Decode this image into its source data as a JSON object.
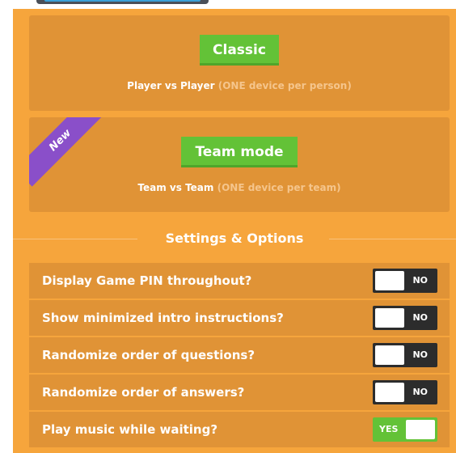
{
  "modes": {
    "classic": {
      "button_label": "Classic",
      "desc_main": "Player vs Player",
      "desc_note": "(ONE device per person)"
    },
    "team": {
      "badge": "New",
      "button_label": "Team mode",
      "desc_main": "Team vs Team",
      "desc_note": "(ONE device per team)"
    }
  },
  "settings": {
    "title": "Settings & Options",
    "items": [
      {
        "label": "Display Game PIN throughout?",
        "state": "NO"
      },
      {
        "label": "Show minimized intro instructions?",
        "state": "NO"
      },
      {
        "label": "Randomize order of questions?",
        "state": "NO"
      },
      {
        "label": "Randomize order of answers?",
        "state": "NO"
      },
      {
        "label": "Play music while waiting?",
        "state": "YES"
      }
    ]
  },
  "colors": {
    "panel": "#f6a53c",
    "card": "#e09336",
    "button_green": "#63c237",
    "ribbon_purple": "#8a4fc9",
    "toggle_off": "#2c2c2c"
  }
}
